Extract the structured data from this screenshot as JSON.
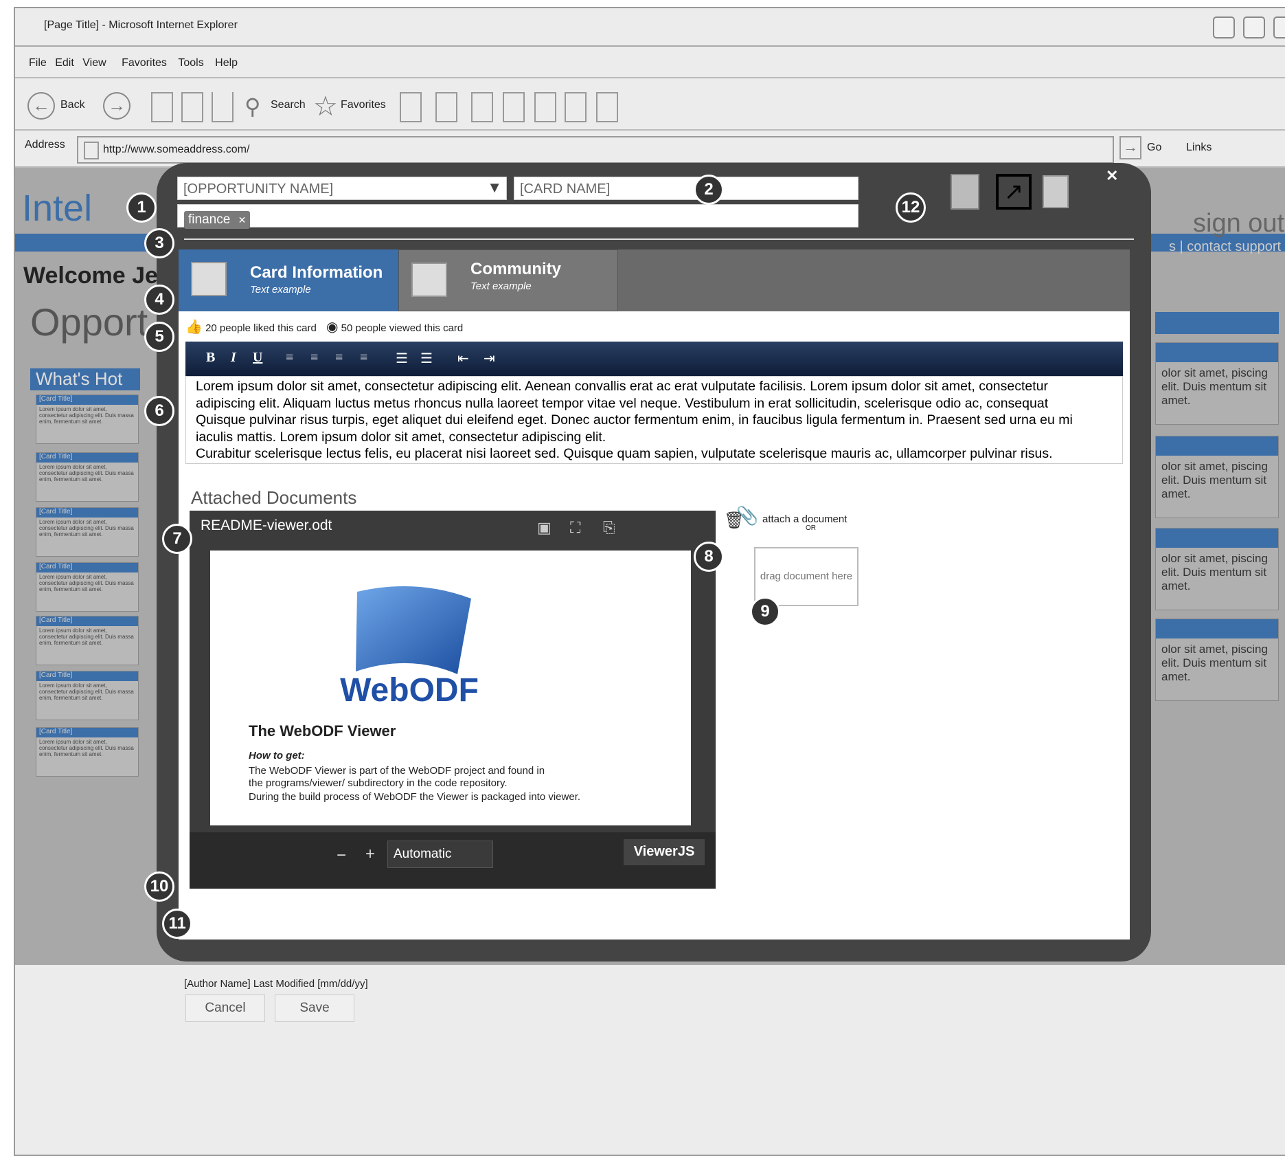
{
  "browser": {
    "title": "[Page Title] - Microsoft Internet Explorer",
    "menu": [
      "File",
      "Edit",
      "View",
      "Favorites",
      "Tools",
      "Help"
    ],
    "toolbar": {
      "back": "Back",
      "search": "Search",
      "favorites": "Favorites"
    },
    "address_label": "Address",
    "address": "http://www.someaddress.com/",
    "go": "Go",
    "links": "Links"
  },
  "background": {
    "logo": "Intel",
    "welcome": "Welcome Je",
    "heading": "Opport",
    "whats_hot": "What's Hot",
    "card_title": "[Card Title]",
    "card_text": "Lorem ipsum dolor sit amet, consectetur adipiscing elit. Duis massa enim, fermentum sit amet.",
    "sign_out": "sign out",
    "contact": "s  | contact support",
    "right_card_text": "olor sit amet, piscing elit. Duis mentum sit amet."
  },
  "modal": {
    "opportunity": "[OPPORTUNITY NAME]",
    "card_name": "[CARD NAME]",
    "tag": "finance",
    "tabs": [
      {
        "title": "Card Information",
        "sub": "Text example"
      },
      {
        "title": "Community",
        "sub": "Text example"
      }
    ],
    "likes": "20 people liked this card",
    "views": "50 people viewed this card",
    "body": [
      " Lorem ipsum dolor sit amet, consectetur adipiscing elit. Aenean convallis erat ac erat vulputate facilisis. Lorem ipsum dolor sit amet, consectetur",
      "adipiscing elit. Aliquam luctus metus rhoncus nulla laoreet tempor vitae vel neque. Vestibulum in erat sollicitudin, scelerisque odio ac, consequat",
      "Quisque pulvinar risus turpis, eget aliquet dui eleifend eget. Donec auctor fermentum enim, in faucibus ligula fermentum in. Praesent sed urna eu mi",
      "iaculis mattis. Lorem ipsum dolor sit amet, consectetur adipiscing elit.",
      "Curabitur scelerisque lectus felis, eu placerat nisi laoreet sed. Quisque quam sapien, vulputate scelerisque mauris ac, ullamcorper pulvinar risus."
    ],
    "attached_label": "Attached Documents",
    "viewer": {
      "filename": "README-viewer.odt",
      "logo": "WebODF",
      "doc_title": "The WebODF Viewer",
      "how": "How to get:",
      "para": "The WebODF Viewer is part of the WebODF project and found in the programs/viewer/ subdirectory in the code repository.",
      "para2": "During the build process of WebODF the Viewer is packaged into viewer.",
      "zoom": "Automatic",
      "brand": "ViewerJS"
    },
    "attach": "attach a document",
    "or": "OR",
    "drag": "drag document here",
    "meta": "[Author Name] Last Modified [mm/dd/yy]",
    "cancel": "Cancel",
    "save": "Save",
    "numbers": [
      "1",
      "2",
      "3",
      "4",
      "5",
      "6",
      "7",
      "8",
      "9",
      "10",
      "11",
      "12"
    ]
  }
}
